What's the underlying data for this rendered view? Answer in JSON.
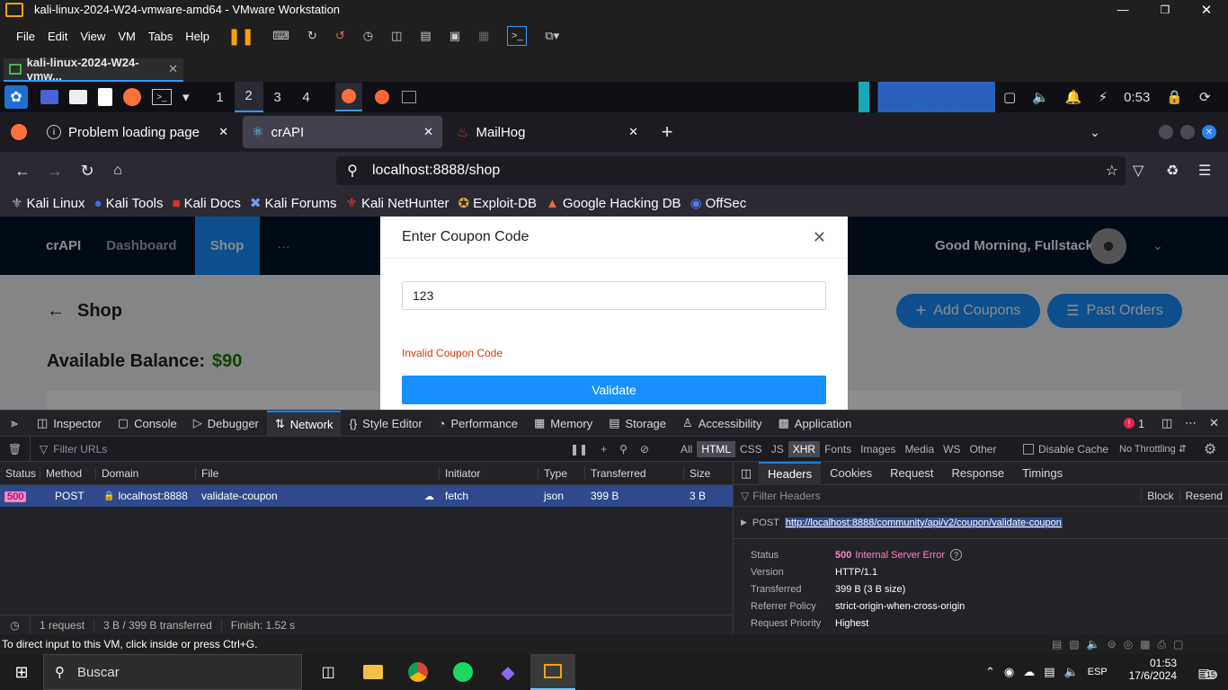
{
  "vm": {
    "title": "kali-linux-2024-W24-vmware-amd64 - VMware Workstation",
    "menu": [
      "File",
      "Edit",
      "View",
      "VM",
      "Tabs",
      "Help"
    ],
    "tab_label": "kali-linux-2024-W24-vmw...",
    "status_text": "To direct input to this VM, click inside or press Ctrl+G."
  },
  "kali": {
    "workspaces": [
      "1",
      "2",
      "3",
      "4"
    ],
    "clock": "0:53"
  },
  "firefox": {
    "tabs": [
      {
        "label": "Problem loading page"
      },
      {
        "label": "crAPI"
      },
      {
        "label": "MailHog"
      }
    ],
    "url": "localhost:8888/shop",
    "bookmarks": [
      "Kali Linux",
      "Kali Tools",
      "Kali Docs",
      "Kali Forums",
      "Kali NetHunter",
      "Exploit-DB",
      "Google Hacking DB",
      "OffSec"
    ]
  },
  "app": {
    "brand": "crAPI",
    "nav": [
      "Dashboard",
      "Shop",
      "···"
    ],
    "greeting": "Good Morning, Fullstack!",
    "page_title": "Shop",
    "balance_label": "Available Balance:",
    "balance_value": "$90",
    "add_coupons": "Add Coupons",
    "past_orders": "Past Orders"
  },
  "modal": {
    "title": "Enter Coupon Code",
    "input_value": "123",
    "error": "Invalid Coupon Code",
    "validate_label": "Validate"
  },
  "devtools": {
    "tools": [
      "Inspector",
      "Console",
      "Debugger",
      "Network",
      "Style Editor",
      "Performance",
      "Memory",
      "Storage",
      "Accessibility",
      "Application"
    ],
    "error_count": "1",
    "filter_placeholder": "Filter URLs",
    "types": [
      "All",
      "HTML",
      "CSS",
      "JS",
      "XHR",
      "Fonts",
      "Images",
      "Media",
      "WS",
      "Other"
    ],
    "disable_cache": "Disable Cache",
    "throttling": "No Throttling",
    "columns": [
      "Status",
      "Method",
      "Domain",
      "File",
      "Initiator",
      "Type",
      "Transferred",
      "Size"
    ],
    "request": {
      "status": "500",
      "method": "POST",
      "domain": "localhost:8888",
      "file": "validate-coupon",
      "initiator": "fetch",
      "type": "json",
      "transferred": "399 B",
      "size": "3 B"
    },
    "summary": {
      "requests": "1 request",
      "transferred": "3 B / 399 B transferred",
      "finish": "Finish: 1.52 s"
    },
    "side_tabs": [
      "Headers",
      "Cookies",
      "Request",
      "Response",
      "Timings"
    ],
    "filter_headers": "Filter Headers",
    "block": "Block",
    "resend": "Resend",
    "req_method": "POST",
    "req_url": "http://localhost:8888/community/api/v2/coupon/validate-coupon",
    "details": [
      {
        "label": "Status",
        "value": "Internal Server Error",
        "code": "500"
      },
      {
        "label": "Version",
        "value": "HTTP/1.1"
      },
      {
        "label": "Transferred",
        "value": "399 B (3 B size)"
      },
      {
        "label": "Referrer Policy",
        "value": "strict-origin-when-cross-origin"
      },
      {
        "label": "Request Priority",
        "value": "Highest"
      }
    ]
  },
  "taskbar": {
    "search": "Buscar",
    "lang": "ESP",
    "time": "01:53",
    "date": "17/6/2024",
    "notif": "15"
  },
  "colors": {
    "accent": "#1890ff",
    "nav_bg": "#001529",
    "error": "#d4380d",
    "status_500": "#ff82c8"
  }
}
